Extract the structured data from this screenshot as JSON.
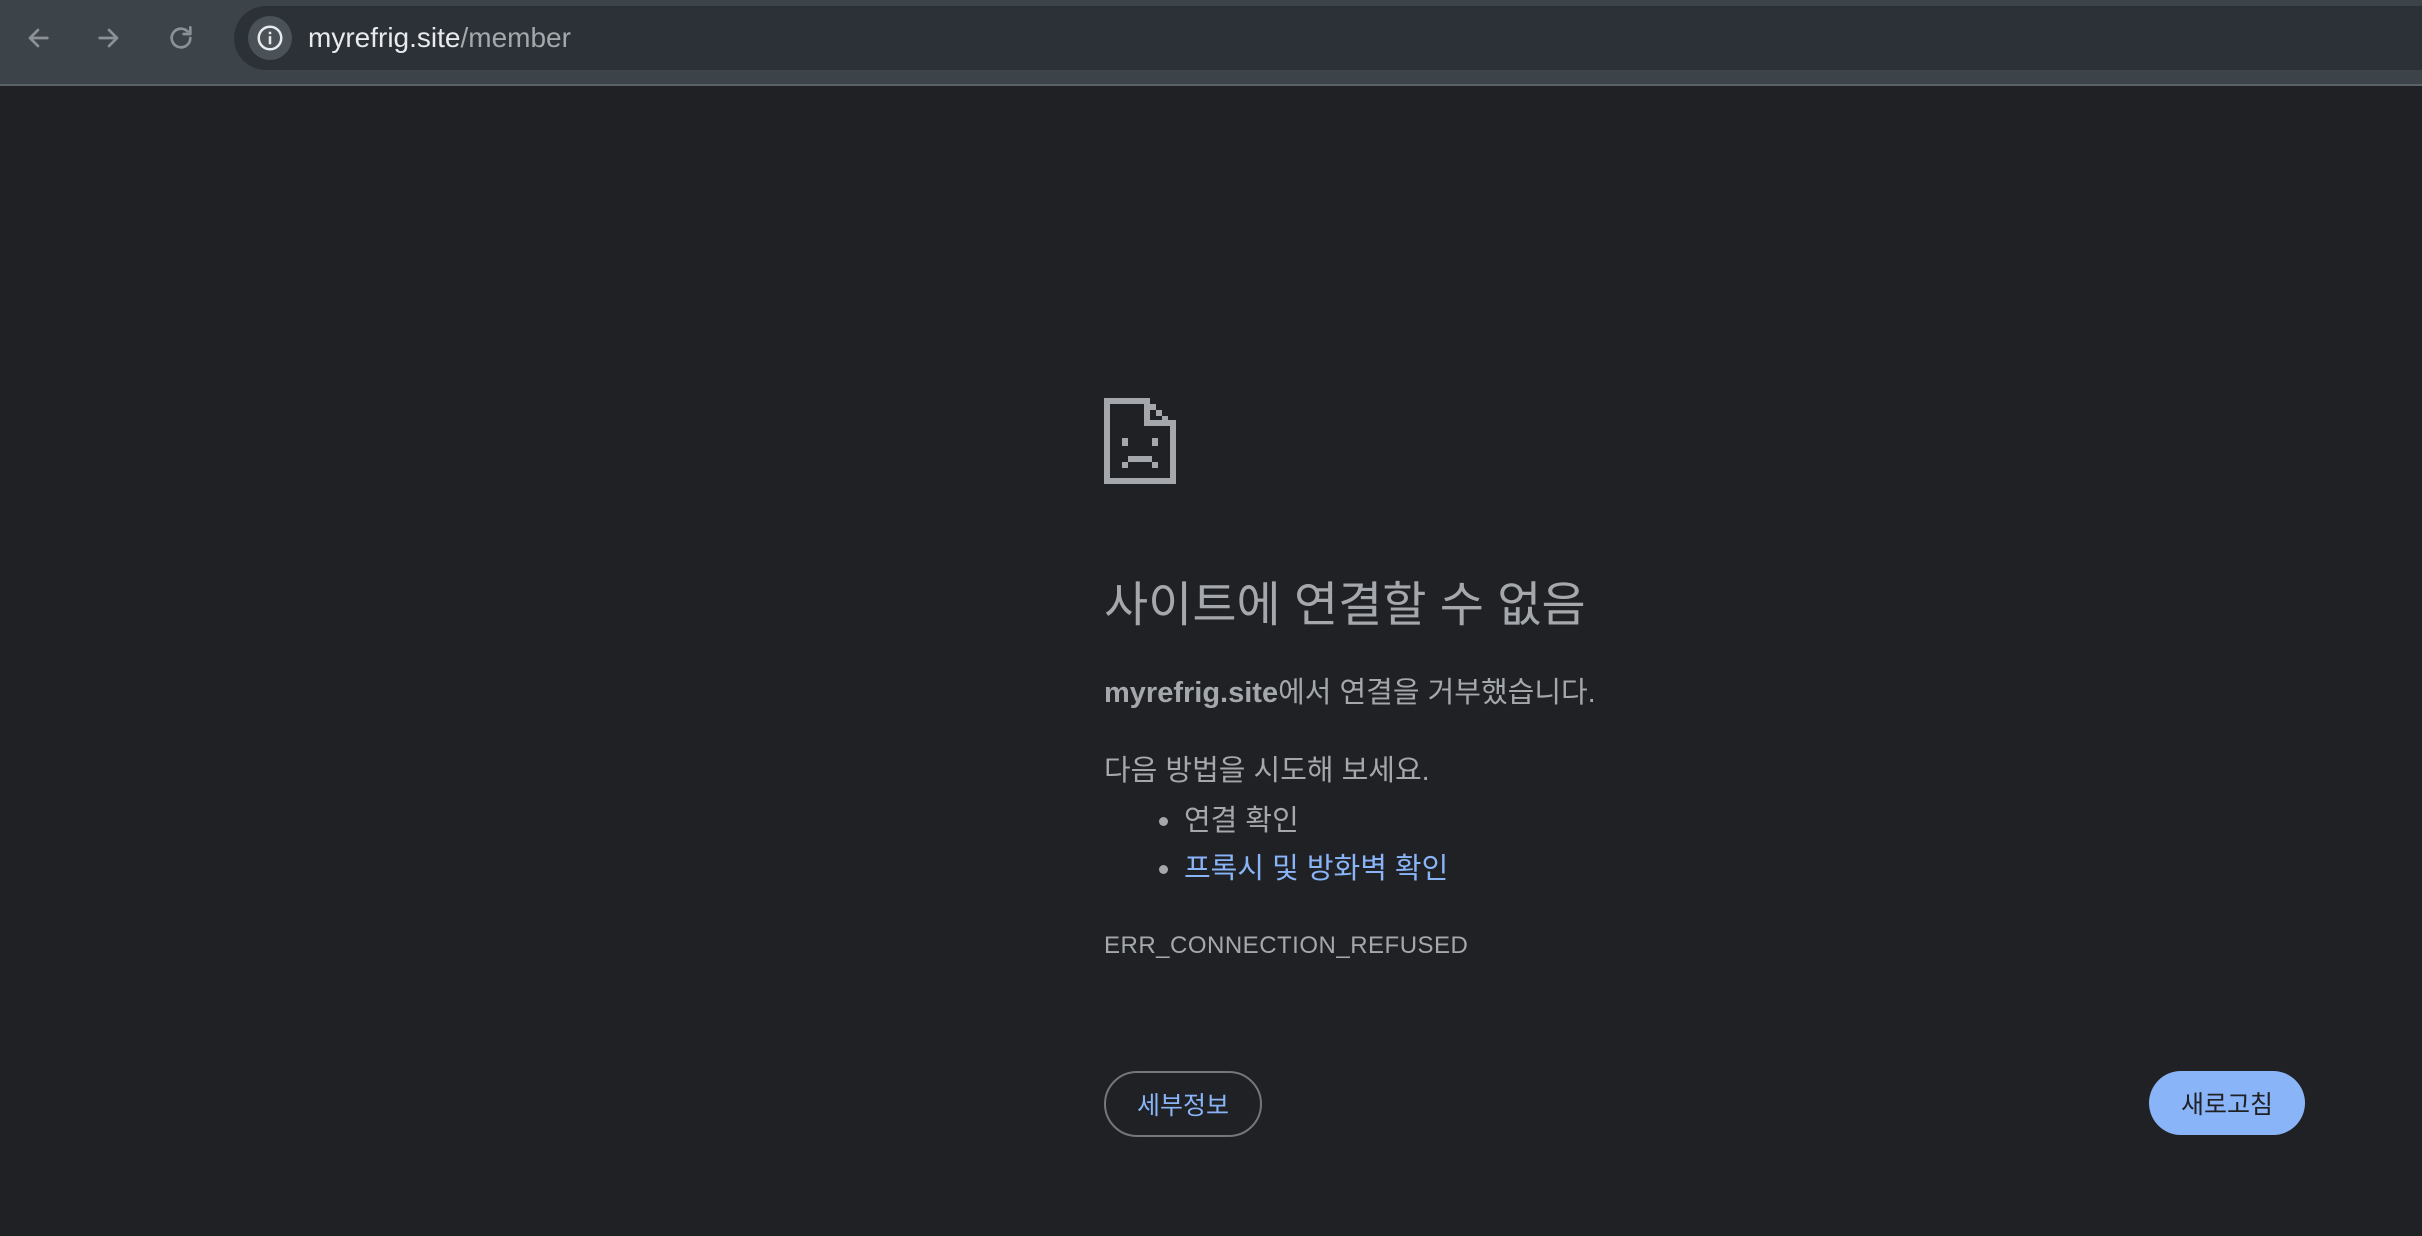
{
  "toolbar": {
    "back_icon": "arrow-left-icon",
    "forward_icon": "arrow-right-icon",
    "reload_icon": "reload-icon",
    "site_info_icon": "info-icon",
    "url_host": "myrefrig.site",
    "url_path": "/member"
  },
  "error": {
    "icon": "sad-document-icon",
    "heading": "사이트에 연결할 수 없음",
    "summary_host": "myrefrig.site",
    "summary_rest": "에서 연결을 거부했습니다.",
    "suggestions_title": "다음 방법을 시도해 보세요.",
    "suggestions": [
      {
        "label": "연결 확인",
        "link": false
      },
      {
        "label": "프록시 및 방화벽 확인",
        "link": true
      }
    ],
    "code": "ERR_CONNECTION_REFUSED"
  },
  "buttons": {
    "details_label": "세부정보",
    "reload_label": "새로고침"
  },
  "colors": {
    "background": "#202124",
    "toolbar": "#3c4349",
    "text": "#a4a8ac",
    "link": "#8ab4f8",
    "primary_button": "#8ab4f8"
  }
}
